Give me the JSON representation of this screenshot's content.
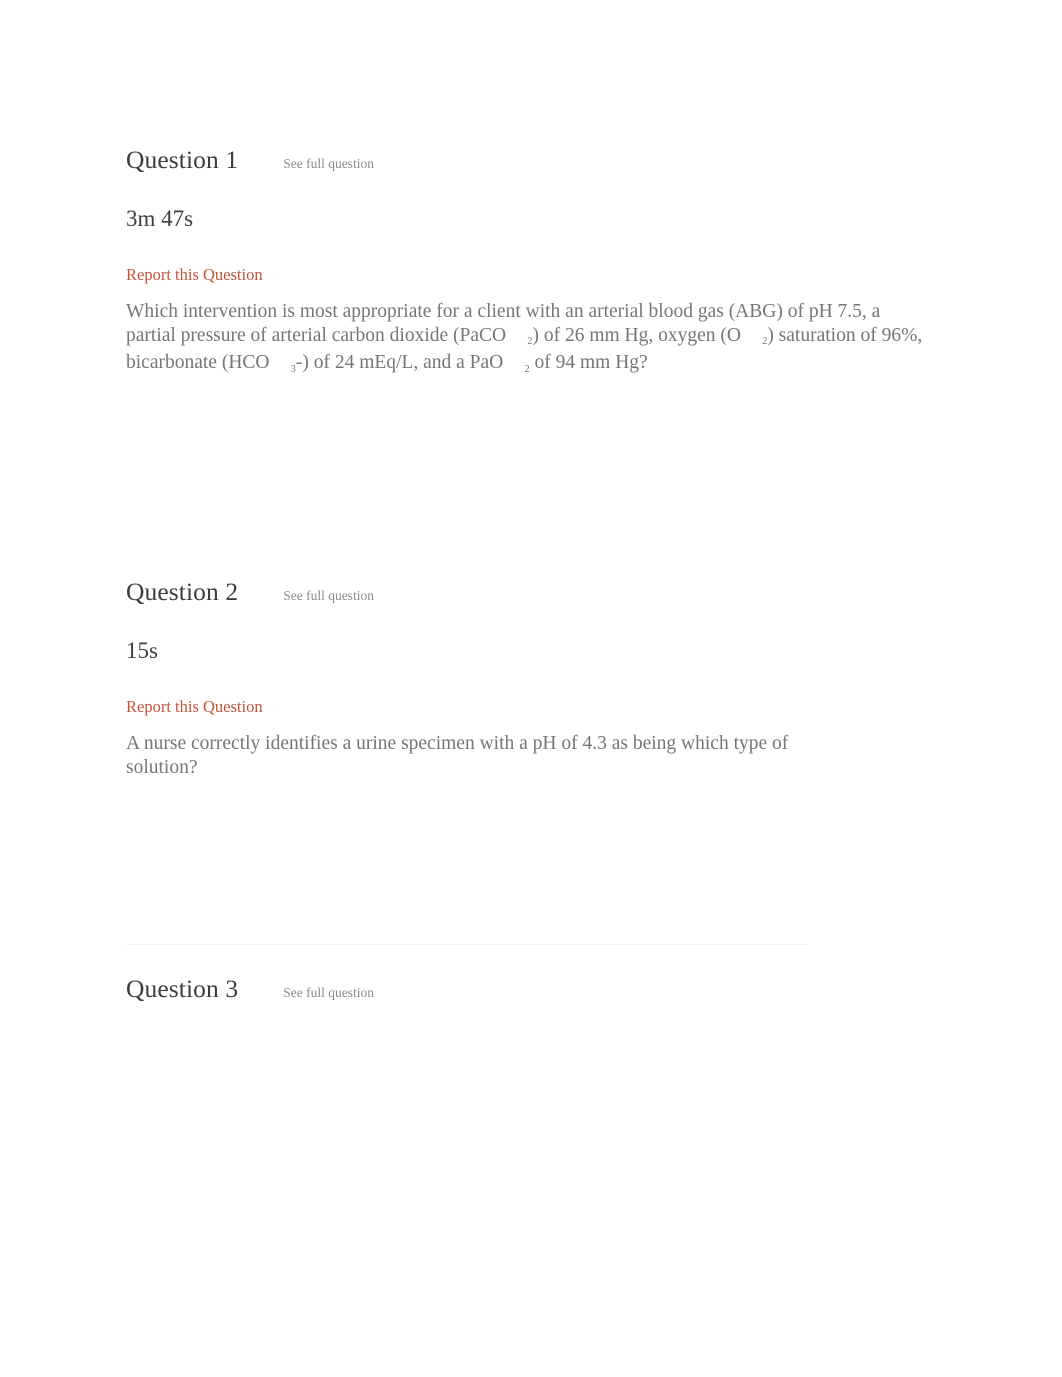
{
  "page": {
    "see_full_question_label": "See full question",
    "report_label": "Report this Question"
  },
  "questions": [
    {
      "title": "Question 1",
      "see_full": "See full question",
      "timer": "3m 47s",
      "report": "Report this Question",
      "body_parts": {
        "p1": "Which intervention is most appropriate for a client with an arterial blood gas (ABG) of pH 7.5, a partial pressure of arterial carbon dioxide (PaCO",
        "sub1": "2",
        "p2": ") of 26 mm Hg, oxygen (O",
        "sub2": "2",
        "p3": ") saturation of 96%, bicarbonate (HCO",
        "sub3": "3",
        "p4": "-) of 24 mEq/L, and a PaO",
        "sub4": "2",
        "p5": " of 94 mm Hg?"
      },
      "body_plain": "Which intervention is most appropriate for a client with an arterial blood gas (ABG) of pH 7.5, a partial pressure of arterial carbon dioxide (PaCO2) of 26 mm Hg, oxygen (O2) saturation of 96%, bicarbonate (HCO3-) of 24 mEq/L, and a PaO2 of 94 mm Hg?"
    },
    {
      "title": "Question 2",
      "see_full": "See full question",
      "timer": "15s",
      "report": "Report this Question",
      "body_plain": "A nurse correctly identifies a urine specimen with a pH of 4.3 as being which type of solution?"
    },
    {
      "title": "Question 3",
      "see_full": "See full question"
    }
  ]
}
